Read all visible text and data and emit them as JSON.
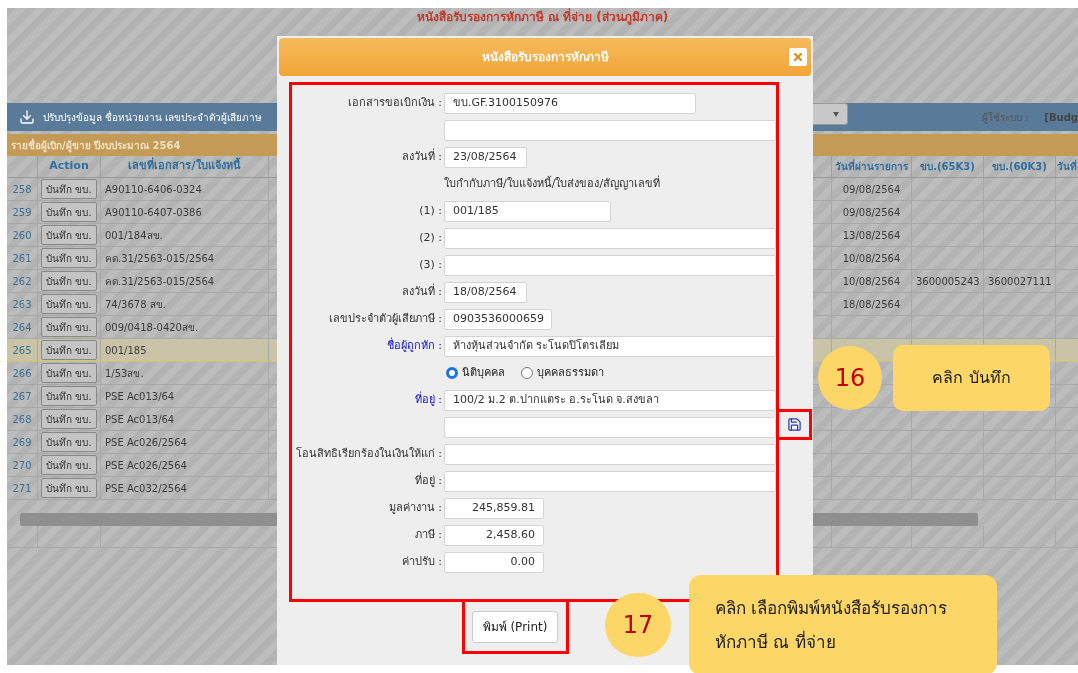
{
  "page": {
    "title": "หนังสือรับรองการหักภาษี ณ ที่จ่าย (ส่วนภูมิภาค)",
    "toolbar_label": "ปรับปรุงข้อมูล ชื่อหน่วยงาน เลขประจำตัวผู้เสียภาษ",
    "user_label": "ผู้ใช้ระบบ :",
    "user_value": "[Budg",
    "list_title": "รายชื่อผู้เบิก/ผู้ขาย ปีงบประมาณ 2564"
  },
  "table": {
    "columns": [
      "Action",
      "เลขที่เอกสาร/ใบแจ้งหนี้",
      "วันที่ผ่านรายการ",
      "ขบ.(65K3)",
      "ขบ.(60K3)",
      "วันที่"
    ],
    "rows": [
      {
        "no": "258",
        "action": "บันทึก ขบ.",
        "doc": "A90110-6406-0324",
        "posted": "09/08/2564",
        "selected": false
      },
      {
        "no": "259",
        "action": "บันทึก ขบ.",
        "doc": "A90110-6407-0386",
        "posted": "09/08/2564",
        "selected": false
      },
      {
        "no": "260",
        "action": "บันทึก ขบ.",
        "doc": "001/184สข.",
        "posted": "13/08/2564",
        "selected": false
      },
      {
        "no": "261",
        "action": "บันทึก ขบ.",
        "doc": "คด.31/2563-015/2564",
        "posted": "10/08/2564",
        "selected": false
      },
      {
        "no": "262",
        "action": "บันทึก ขบ.",
        "doc": "คด.31/2563-015/2564",
        "posted": "10/08/2564",
        "k65": "3600005243",
        "k60": "3600027111",
        "selected": false
      },
      {
        "no": "263",
        "action": "บันทึก ขบ.",
        "doc": "74/3678 สข.",
        "posted": "18/08/2564",
        "selected": false
      },
      {
        "no": "264",
        "action": "บันทึก ขบ.",
        "doc": "009/0418-0420สข.",
        "selected": false
      },
      {
        "no": "265",
        "action": "บันทึก ขบ.",
        "doc": "001/185",
        "selected": true
      },
      {
        "no": "266",
        "action": "บันทึก ขบ.",
        "doc": "1/53สข.",
        "selected": false
      },
      {
        "no": "267",
        "action": "บันทึก ขบ.",
        "doc": "PSE Ac013/64",
        "selected": false
      },
      {
        "no": "268",
        "action": "บันทึก ขบ.",
        "doc": "PSE Ac013/64",
        "selected": false
      },
      {
        "no": "269",
        "action": "บันทึก ขบ.",
        "doc": "PSE Ac026/2564",
        "selected": false
      },
      {
        "no": "270",
        "action": "บันทึก ขบ.",
        "doc": "PSE Ac026/2564",
        "selected": false
      },
      {
        "no": "271",
        "action": "บันทึก ขบ.",
        "doc": "PSE Ac032/2564",
        "selected": false
      }
    ]
  },
  "dialog": {
    "title": "หนังสือรับรองการหักภาษี",
    "items": [
      {
        "kind": "reference",
        "label": "เอกสารขอเบิกเงิน :",
        "value": "ขบ.GF.3100150976"
      },
      {
        "kind": "text"
      },
      {
        "kind": "date",
        "label": "ลงวันที่ :",
        "value": "23/08/2564"
      },
      {
        "kind": "note",
        "text": "ใบกำกับภาษี/ใบแจ้งหนี้/ใบส่งของ/สัญญาเลขที่"
      },
      {
        "kind": "number",
        "label": "(1) :",
        "value": "001/185"
      },
      {
        "kind": "text",
        "label": "(2) :"
      },
      {
        "kind": "text",
        "label": "(3) :"
      },
      {
        "kind": "date",
        "label": "ลงวันที่ :",
        "value": "18/08/2564"
      },
      {
        "kind": "taxid",
        "label": "เลขประจำตัวผู้เสียภาษี :",
        "value": "0903536000659"
      },
      {
        "kind": "text",
        "label": "ชื่อผู้ถูกหัก :",
        "emphasis": true,
        "value": "ห้างหุ้นส่วนจำกัด ระโนดปิโตรเลียม"
      },
      {
        "kind": "radio",
        "options": [
          {
            "label": "นิติบุคคล",
            "selected": true
          },
          {
            "label": "บุคคลธรรมดา",
            "selected": false
          }
        ]
      },
      {
        "kind": "text",
        "label": "ที่อยู่ :",
        "emphasis": true,
        "value": "100/2 ม.2 ต.ปากแตระ อ.ระโนด จ.สงขลา"
      },
      {
        "kind": "text"
      },
      {
        "kind": "text",
        "label": "โอนสิทธิเรียกร้องในเงินให้แก่ :"
      },
      {
        "kind": "text",
        "label": "ที่อยู่ :"
      },
      {
        "kind": "amount",
        "label": "มูลค่างาน :",
        "value": "245,859.81"
      },
      {
        "kind": "amount",
        "label": "ภาษี :",
        "value": "2,458.60"
      },
      {
        "kind": "amount",
        "label": "ค่าปรับ :",
        "value": "0.00"
      }
    ],
    "print_button": "พิมพ์ (Print)"
  },
  "callouts": [
    {
      "step": "16",
      "text": "คลิก บันทึก"
    },
    {
      "step": "17",
      "text": "คลิก เลือกพิมพ์หนังสือรับรองการหักภาษี ณ ที่จ่าย"
    }
  ]
}
